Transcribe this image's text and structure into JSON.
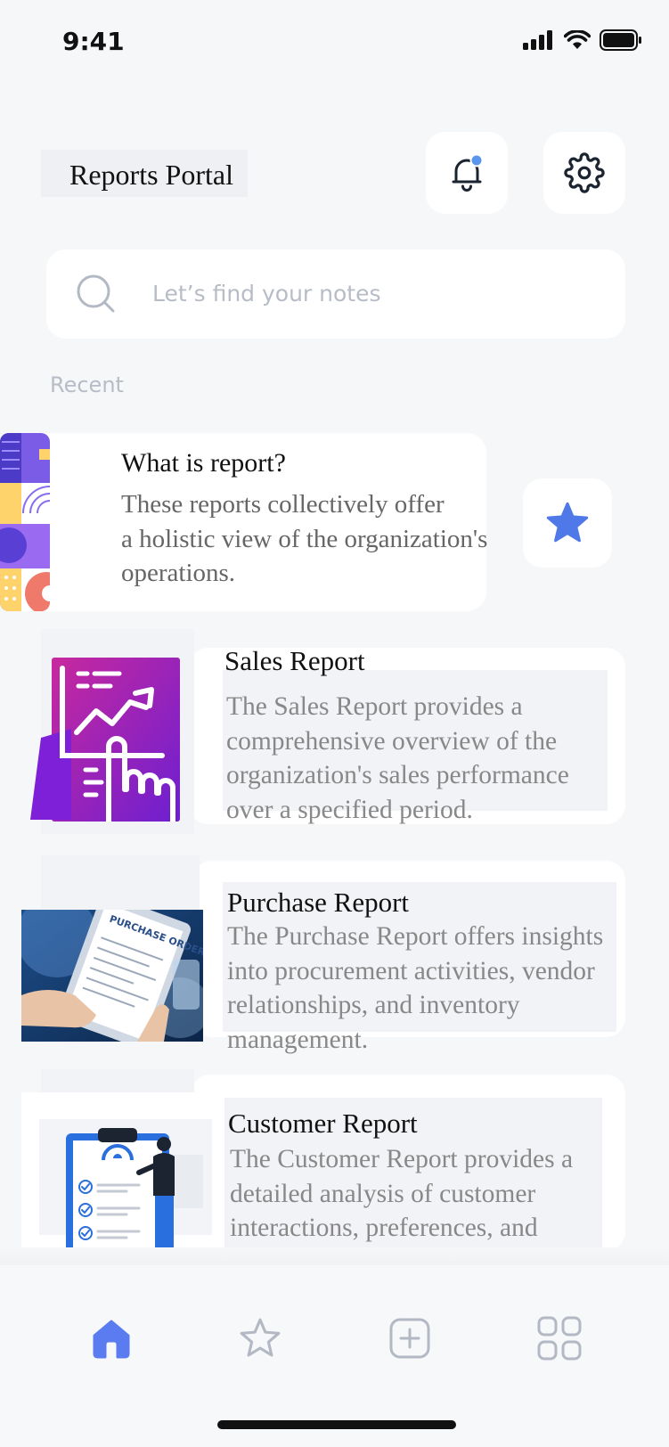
{
  "status_bar": {
    "time": "9:41"
  },
  "header": {
    "title": "Reports Portal"
  },
  "search": {
    "placeholder": "Let’s find your notes"
  },
  "recent": {
    "label": "Recent",
    "featured": {
      "title": "What is report?",
      "description": "These reports collectively offer\n a holistic view of the organization's\noperations."
    }
  },
  "reports": [
    {
      "title": "Sales Report",
      "description": "The Sales Report provides a comprehensive overview of the organization's sales performance over a specified period."
    },
    {
      "title": "Purchase Report",
      "image_text": "PURCHASE ORDER",
      "description": "The Purchase Report offers insights into procurement activities, vendor relationships, and inventory management."
    },
    {
      "title": "Customer Report",
      "description": "The Customer Report provides a detailed analysis of customer interactions, preferences, and retention efforts."
    }
  ],
  "nav": {
    "items": [
      {
        "icon": "home-icon",
        "active": true
      },
      {
        "icon": "star-icon",
        "active": false
      },
      {
        "icon": "add-icon",
        "active": false
      },
      {
        "icon": "grid-icon",
        "active": false
      }
    ]
  },
  "colors": {
    "accent": "#5b7cf0",
    "background": "#f6f7f9",
    "muted_text": "#b7bcc6",
    "card_text": "#888888"
  }
}
